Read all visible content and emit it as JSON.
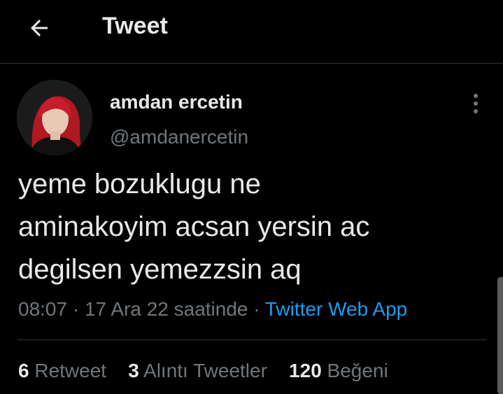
{
  "header": {
    "title": "Tweet",
    "back_icon": "arrow-left-icon"
  },
  "author": {
    "display_name": "amdan ercetin",
    "handle": "@amdanercetin",
    "more_icon": "vertical-ellipsis-icon"
  },
  "tweet": {
    "lines": [
      "yeme bozuklugu ne",
      "aminakoyim acsan yersin ac",
      "degilsen yemezzsin aq"
    ],
    "time": "08:07",
    "separator": "·",
    "date": "17 Ara 22 saatinde",
    "source": "Twitter Web App"
  },
  "stats": {
    "retweets_count": "6",
    "retweets_label": "Retweet",
    "quotes_count": "3",
    "quotes_label": "Alıntı Tweetler",
    "likes_count": "120",
    "likes_label": "Beğeni"
  },
  "colors": {
    "background": "#000000",
    "text_primary": "#e7e9ea",
    "text_secondary": "#71767b",
    "link": "#1d9bf0",
    "divider": "#2f3336"
  }
}
